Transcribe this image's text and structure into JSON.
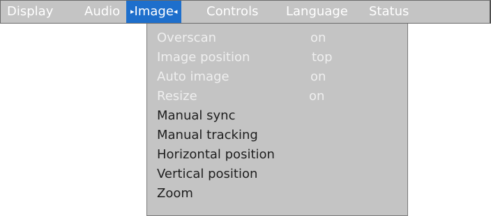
{
  "menubar": {
    "items": [
      {
        "label": "Display"
      },
      {
        "label": "Audio"
      },
      {
        "label": "Image",
        "active": true
      },
      {
        "label": "Controls"
      },
      {
        "label": "Language"
      },
      {
        "label": "Status"
      }
    ],
    "active_left_marker": "▸",
    "active_right_marker": "◂"
  },
  "dropdown": {
    "items": [
      {
        "label": "Overscan",
        "value": "on",
        "enabled": false
      },
      {
        "label": "Image position",
        "value": "top",
        "enabled": false
      },
      {
        "label": "Auto image",
        "value": "on",
        "enabled": false
      },
      {
        "label": "Resize",
        "value": "on",
        "enabled": false
      },
      {
        "label": "Manual sync",
        "enabled": true
      },
      {
        "label": "Manual tracking",
        "enabled": true
      },
      {
        "label": "Horizontal position",
        "enabled": true
      },
      {
        "label": "Vertical position",
        "enabled": true
      },
      {
        "label": "Zoom",
        "enabled": true
      }
    ]
  },
  "colors": {
    "panel": "#c4c4c4",
    "highlight": "#1e6fcc",
    "disabled_text": "#efefef",
    "enabled_text": "#1e1e1e"
  }
}
